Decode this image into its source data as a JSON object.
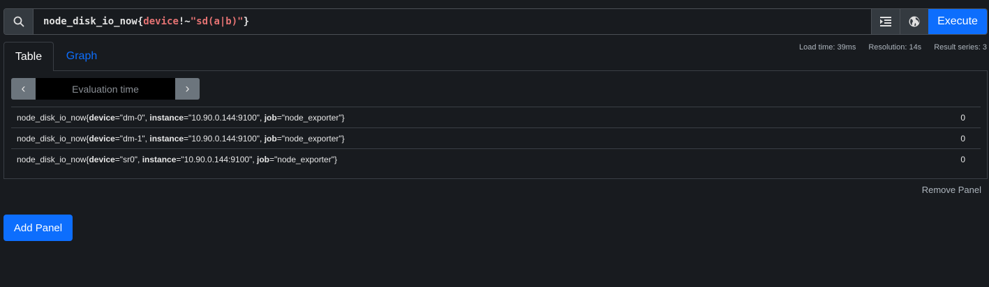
{
  "query": {
    "metric": "node_disk_io_now",
    "open_brace": "{",
    "label": "device",
    "operator": "!~",
    "value": "\"sd(a|b)\"",
    "close_brace": "}"
  },
  "toolbar": {
    "search_icon": "search-icon",
    "format_icon": "format-indent-icon",
    "explorer_icon": "globe-icon",
    "execute_label": "Execute"
  },
  "tabs": [
    {
      "label": "Table",
      "active": true
    },
    {
      "label": "Graph",
      "active": false
    }
  ],
  "stats": {
    "load_time": "Load time: 39ms",
    "resolution": "Resolution: 14s",
    "result_series": "Result series: 3"
  },
  "eval": {
    "placeholder": "Evaluation time",
    "prev": "‹",
    "next": "›"
  },
  "results": [
    {
      "metric": "node_disk_io_now",
      "device": "dm-0",
      "instance": "10.90.0.144:9100",
      "job": "node_exporter",
      "value": "0"
    },
    {
      "metric": "node_disk_io_now",
      "device": "dm-1",
      "instance": "10.90.0.144:9100",
      "job": "node_exporter",
      "value": "0"
    },
    {
      "metric": "node_disk_io_now",
      "device": "sr0",
      "instance": "10.90.0.144:9100",
      "job": "node_exporter",
      "value": "0"
    }
  ],
  "labels": {
    "device": "device",
    "instance": "instance",
    "job": "job"
  },
  "remove_panel": "Remove Panel",
  "add_panel": "Add Panel",
  "colors": {
    "accent": "#0d6efd",
    "background": "#181b1f",
    "query_label": "#e57373"
  }
}
